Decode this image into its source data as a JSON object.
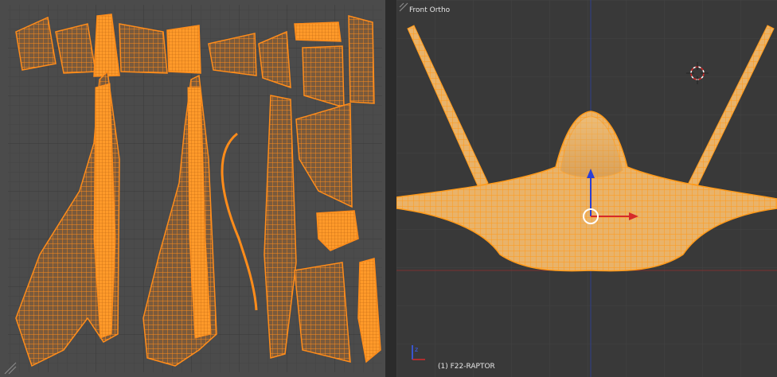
{
  "viewport": {
    "view_label": "Front Ortho",
    "object_label": "(1) F22-RAPTOR"
  },
  "icons": {
    "uv_corner": "corner-resize-icon",
    "viewport_corner": "corner-resize-icon",
    "cursor": "3d-cursor-icon",
    "axis_widget": "axis-gizmo-icon",
    "manipulator": "transform-manipulator-icon"
  },
  "colors": {
    "selection": "#ff8c1a",
    "x_axis": "#d62a2a",
    "z_axis": "#2a3fd6",
    "grid": "#454545",
    "uv_bg": "#4b4b4b",
    "viewport_bg": "#393939"
  }
}
